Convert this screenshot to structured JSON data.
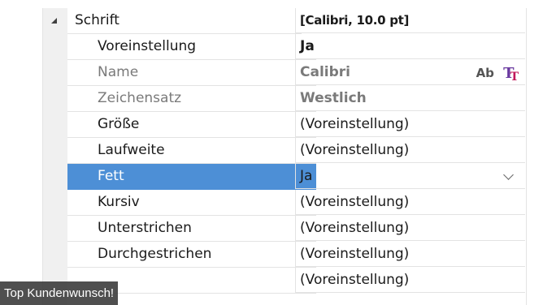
{
  "properties": {
    "category": {
      "label": "Schrift",
      "value": "[Calibri, 10.0 pt]"
    },
    "rows": [
      {
        "label": "Voreinstellung",
        "value": "Ja"
      },
      {
        "label": "Name",
        "value": "Calibri"
      },
      {
        "label": "Zeichensatz",
        "value": "Westlich"
      },
      {
        "label": "Größe",
        "value": "(Voreinstellung)"
      },
      {
        "label": "Laufweite",
        "value": "(Voreinstellung)"
      },
      {
        "label": "Fett",
        "value": "Ja"
      },
      {
        "label": "Kursiv",
        "value": "(Voreinstellung)"
      },
      {
        "label": "Unterstrichen",
        "value": "(Voreinstellung)"
      },
      {
        "label": "Durchgestrichen",
        "value": "(Voreinstellung)"
      },
      {
        "label": "",
        "value": "(Voreinstellung)"
      }
    ],
    "font_icon_text": "Ab",
    "font_icon_glyph": "T"
  },
  "banner": {
    "text": "Top Kundenwunsch!"
  },
  "colors": {
    "selection": "#4d8fd6",
    "gray_text": "#7a7a7a",
    "banner_bg": "#373737"
  }
}
